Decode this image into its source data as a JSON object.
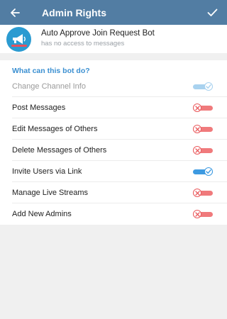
{
  "appbar": {
    "title": "Admin Rights"
  },
  "bot": {
    "name": "Auto Approve Join Request Bot",
    "status": "has no access to messages"
  },
  "section": {
    "header": "What can this bot do?"
  },
  "permissions": [
    {
      "label": "Change Channel Info",
      "state": "on",
      "disabled": true
    },
    {
      "label": "Post Messages",
      "state": "off",
      "disabled": false
    },
    {
      "label": "Edit Messages of Others",
      "state": "off",
      "disabled": false
    },
    {
      "label": "Delete Messages of Others",
      "state": "off",
      "disabled": false
    },
    {
      "label": "Invite Users via Link",
      "state": "on",
      "disabled": false
    },
    {
      "label": "Manage Live Streams",
      "state": "off",
      "disabled": false
    },
    {
      "label": "Add New Admins",
      "state": "off",
      "disabled": false
    }
  ],
  "colors": {
    "appbar": "#527da3",
    "accent": "#3a8fd1",
    "toggle_on": "#3d9ae1",
    "toggle_off": "#ea5a5d"
  }
}
